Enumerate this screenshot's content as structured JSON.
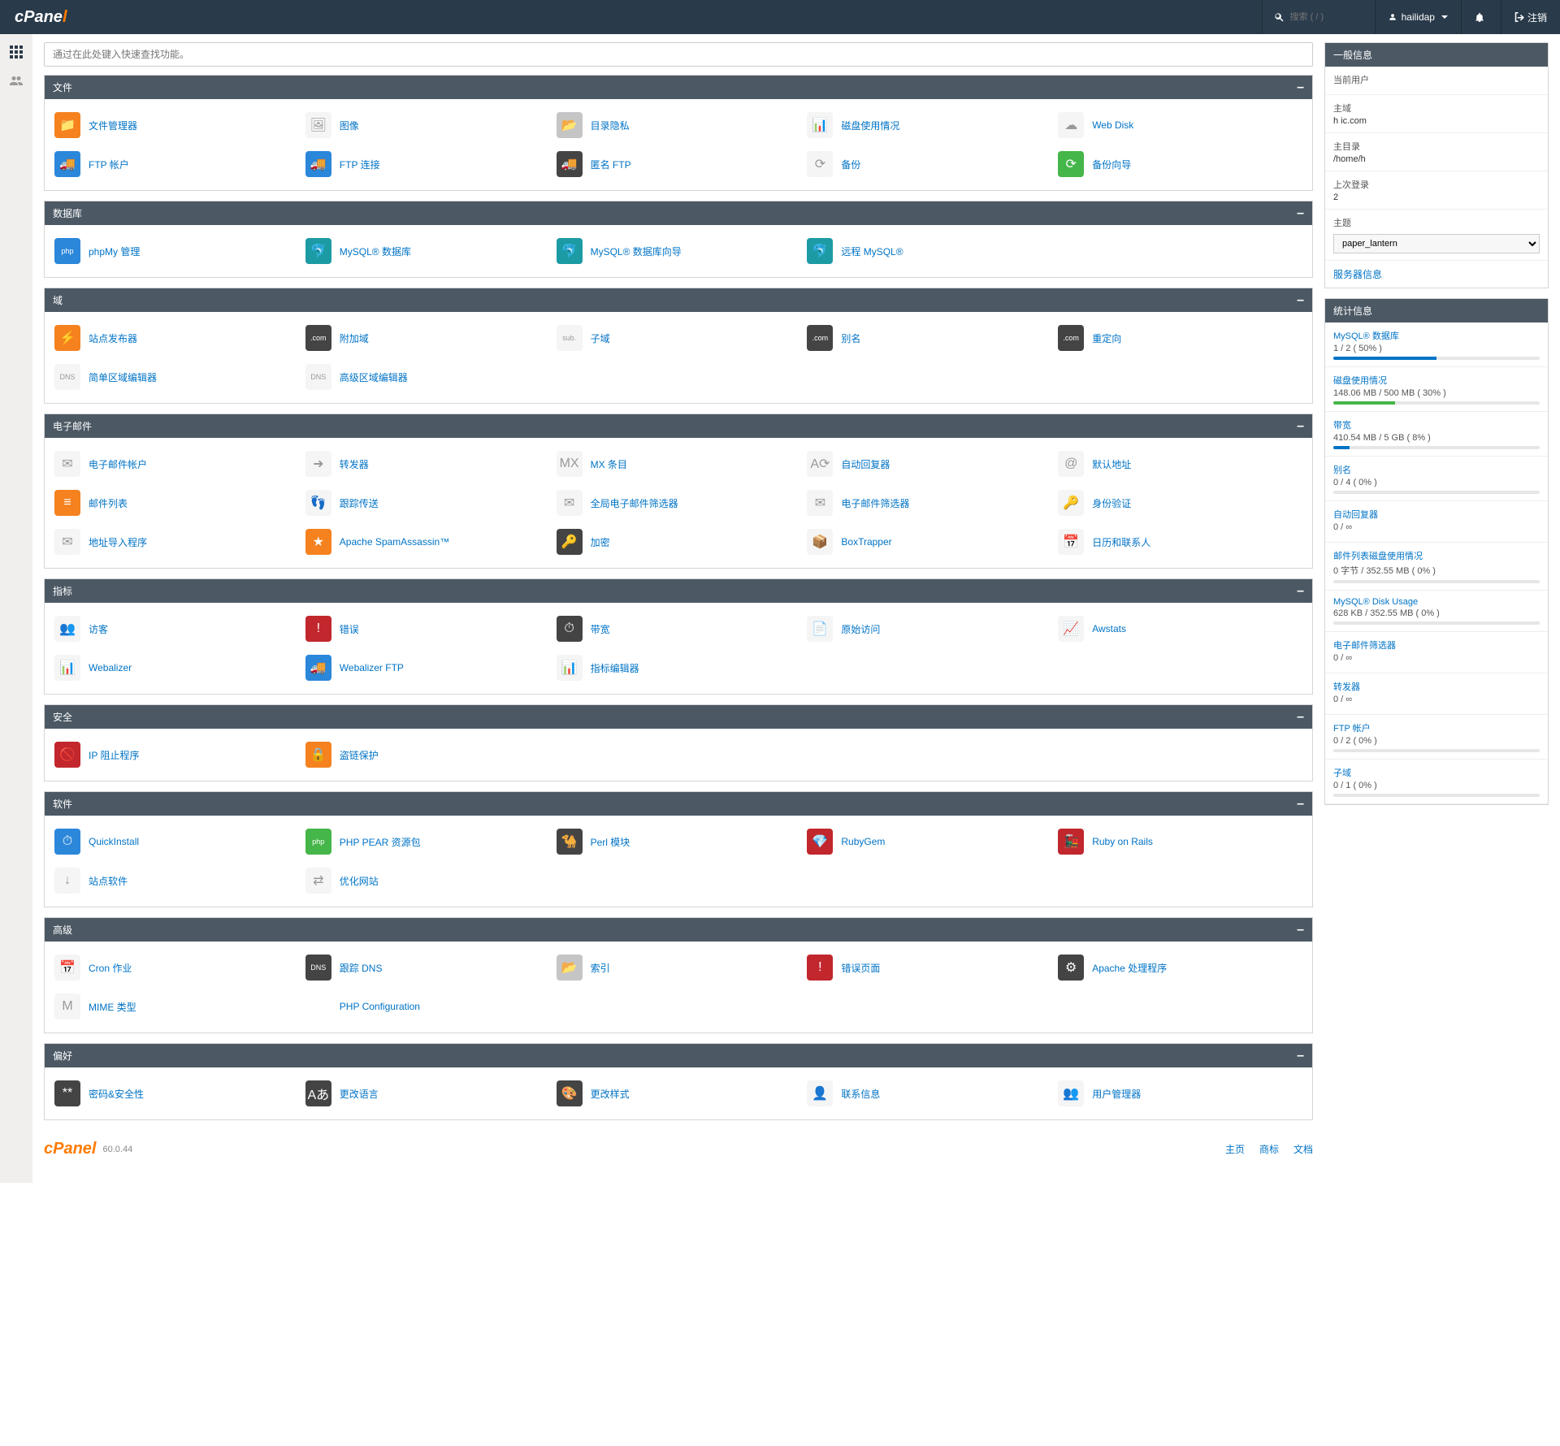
{
  "header": {
    "search_placeholder": "搜索 ( / )",
    "username": "hailidap",
    "logout": "注销"
  },
  "func_search_placeholder": "通过在此处键入快速查找功能。",
  "sections": [
    {
      "title": "文件",
      "items": [
        {
          "label": "文件管理器",
          "ic": "ic-orange",
          "g": "📁"
        },
        {
          "label": "图像",
          "ic": "ic-white",
          "g": "🖼"
        },
        {
          "label": "目录隐私",
          "ic": "ic-gray",
          "g": "📂"
        },
        {
          "label": "磁盘使用情况",
          "ic": "ic-white",
          "g": "📊"
        },
        {
          "label": "Web Disk",
          "ic": "ic-white",
          "g": "☁"
        },
        {
          "label": "FTP 帐户",
          "ic": "ic-blue",
          "g": "🚚"
        },
        {
          "label": "FTP 连接",
          "ic": "ic-blue",
          "g": "🚚"
        },
        {
          "label": "匿名 FTP",
          "ic": "ic-dark",
          "g": "🚚"
        },
        {
          "label": "备份",
          "ic": "ic-white",
          "g": "⟳"
        },
        {
          "label": "备份向导",
          "ic": "ic-green",
          "g": "⟳"
        }
      ]
    },
    {
      "title": "数据库",
      "items": [
        {
          "label": "phpMy 管理",
          "ic": "ic-blue",
          "g": "php"
        },
        {
          "label": "MySQL® 数据库",
          "ic": "ic-teal",
          "g": "🐬"
        },
        {
          "label": "MySQL® 数据库向导",
          "ic": "ic-teal",
          "g": "🐬"
        },
        {
          "label": "远程 MySQL®",
          "ic": "ic-teal",
          "g": "🐬"
        }
      ]
    },
    {
      "title": "域",
      "items": [
        {
          "label": "站点发布器",
          "ic": "ic-orange",
          "g": "⚡"
        },
        {
          "label": "附加域",
          "ic": "ic-dark",
          "g": ".com"
        },
        {
          "label": "子域",
          "ic": "ic-white",
          "g": "sub."
        },
        {
          "label": "别名",
          "ic": "ic-dark",
          "g": ".com"
        },
        {
          "label": "重定向",
          "ic": "ic-dark",
          "g": ".com"
        },
        {
          "label": "简单区域编辑器",
          "ic": "ic-white",
          "g": "DNS"
        },
        {
          "label": "高级区域编辑器",
          "ic": "ic-white",
          "g": "DNS"
        }
      ]
    },
    {
      "title": "电子邮件",
      "items": [
        {
          "label": "电子邮件帐户",
          "ic": "ic-white",
          "g": "✉"
        },
        {
          "label": "转发器",
          "ic": "ic-white",
          "g": "➜"
        },
        {
          "label": "MX 条目",
          "ic": "ic-white",
          "g": "MX"
        },
        {
          "label": "自动回复器",
          "ic": "ic-white",
          "g": "A⟳"
        },
        {
          "label": "默认地址",
          "ic": "ic-white",
          "g": "@"
        },
        {
          "label": "邮件列表",
          "ic": "ic-orange",
          "g": "≡"
        },
        {
          "label": "跟踪传送",
          "ic": "ic-white",
          "g": "👣"
        },
        {
          "label": "全局电子邮件筛选器",
          "ic": "ic-white",
          "g": "✉"
        },
        {
          "label": "电子邮件筛选器",
          "ic": "ic-white",
          "g": "✉"
        },
        {
          "label": "身份验证",
          "ic": "ic-white",
          "g": "🔑"
        },
        {
          "label": "地址导入程序",
          "ic": "ic-white",
          "g": "✉"
        },
        {
          "label": "Apache SpamAssassin™",
          "ic": "ic-orange",
          "g": "★"
        },
        {
          "label": "加密",
          "ic": "ic-dark",
          "g": "🔑"
        },
        {
          "label": "BoxTrapper",
          "ic": "ic-white",
          "g": "📦"
        },
        {
          "label": "日历和联系人",
          "ic": "ic-white",
          "g": "📅"
        }
      ]
    },
    {
      "title": "指标",
      "items": [
        {
          "label": "访客",
          "ic": "ic-white",
          "g": "👥"
        },
        {
          "label": "错误",
          "ic": "ic-red",
          "g": "!"
        },
        {
          "label": "带宽",
          "ic": "ic-dark",
          "g": "⏱"
        },
        {
          "label": "原始访问",
          "ic": "ic-white",
          "g": "📄"
        },
        {
          "label": "Awstats",
          "ic": "ic-white",
          "g": "📈"
        },
        {
          "label": "Webalizer",
          "ic": "ic-white",
          "g": "📊"
        },
        {
          "label": "Webalizer FTP",
          "ic": "ic-blue",
          "g": "🚚"
        },
        {
          "label": "指标编辑器",
          "ic": "ic-white",
          "g": "📊"
        }
      ]
    },
    {
      "title": "安全",
      "items": [
        {
          "label": "IP 阻止程序",
          "ic": "ic-red",
          "g": "🚫"
        },
        {
          "label": "盗链保护",
          "ic": "ic-orange",
          "g": "🔒"
        }
      ]
    },
    {
      "title": "软件",
      "items": [
        {
          "label": "QuickInstall",
          "ic": "ic-blue",
          "g": "⏱"
        },
        {
          "label": "PHP PEAR 资源包",
          "ic": "ic-green",
          "g": "php"
        },
        {
          "label": "Perl 模块",
          "ic": "ic-dark",
          "g": "🐪"
        },
        {
          "label": "RubyGem",
          "ic": "ic-red",
          "g": "💎"
        },
        {
          "label": "Ruby on Rails",
          "ic": "ic-red",
          "g": "🚂"
        },
        {
          "label": "站点软件",
          "ic": "ic-white",
          "g": "↓"
        },
        {
          "label": "优化网站",
          "ic": "ic-white",
          "g": "⇄"
        }
      ]
    },
    {
      "title": "高级",
      "items": [
        {
          "label": "Cron 作业",
          "ic": "ic-white",
          "g": "📅"
        },
        {
          "label": "跟踪 DNS",
          "ic": "ic-dark",
          "g": "DNS"
        },
        {
          "label": "索引",
          "ic": "ic-gray",
          "g": "📂"
        },
        {
          "label": "错误页面",
          "ic": "ic-red",
          "g": "!"
        },
        {
          "label": "Apache 处理程序",
          "ic": "ic-dark",
          "g": "⚙"
        },
        {
          "label": "MIME 类型",
          "ic": "ic-white",
          "g": "M"
        },
        {
          "label": "PHP Configuration",
          "ic": "",
          "g": ""
        }
      ]
    },
    {
      "title": "偏好",
      "items": [
        {
          "label": "密码&安全性",
          "ic": "ic-dark",
          "g": "**"
        },
        {
          "label": "更改语言",
          "ic": "ic-dark",
          "g": "Aあ"
        },
        {
          "label": "更改样式",
          "ic": "ic-dark",
          "g": "🎨"
        },
        {
          "label": "联系信息",
          "ic": "ic-white",
          "g": "👤"
        },
        {
          "label": "用户管理器",
          "ic": "ic-white",
          "g": "👥"
        }
      ]
    }
  ],
  "general_info": {
    "title": "一般信息",
    "rows": [
      {
        "label": "当前用户",
        "value": ""
      },
      {
        "label": "主域",
        "value": "h            ic.com"
      },
      {
        "label": "主目录",
        "value": "/home/h"
      },
      {
        "label": "上次登录",
        "value": "2"
      }
    ],
    "theme_label": "主题",
    "theme_value": "paper_lantern",
    "server_info": "服务器信息"
  },
  "stats": {
    "title": "统计信息",
    "rows": [
      {
        "label": "MySQL® 数据库",
        "value": "1 / 2 ( 50% )",
        "pct": 50
      },
      {
        "label": "磁盘使用情况",
        "value": "148.06 MB / 500 MB ( 30% )",
        "pct": 30,
        "color": "#45b649"
      },
      {
        "label": "带宽",
        "value": "410.54 MB / 5 GB ( 8% )",
        "pct": 8
      },
      {
        "label": "别名",
        "value": "0 / 4 ( 0% )",
        "pct": 0
      },
      {
        "label": "自动回复器",
        "value": "0 / ∞",
        "pct": 0,
        "nobar": true
      },
      {
        "label": "邮件列表磁盘使用情况",
        "value": "0 字节 / 352.55 MB ( 0% )",
        "pct": 0
      },
      {
        "label": "MySQL® Disk Usage",
        "value": "628 KB / 352.55 MB ( 0% )",
        "pct": 0
      },
      {
        "label": "电子邮件筛选器",
        "value": "0 / ∞",
        "pct": 0,
        "nobar": true
      },
      {
        "label": "转发器",
        "value": "0 / ∞",
        "pct": 0,
        "nobar": true
      },
      {
        "label": "FTP 帐户",
        "value": "0 / 2 ( 0% )",
        "pct": 0
      },
      {
        "label": "子域",
        "value": "0 / 1 ( 0% )",
        "pct": 0
      }
    ]
  },
  "footer": {
    "version": "60.0.44",
    "links": [
      "主页",
      "商标",
      "文档"
    ]
  }
}
